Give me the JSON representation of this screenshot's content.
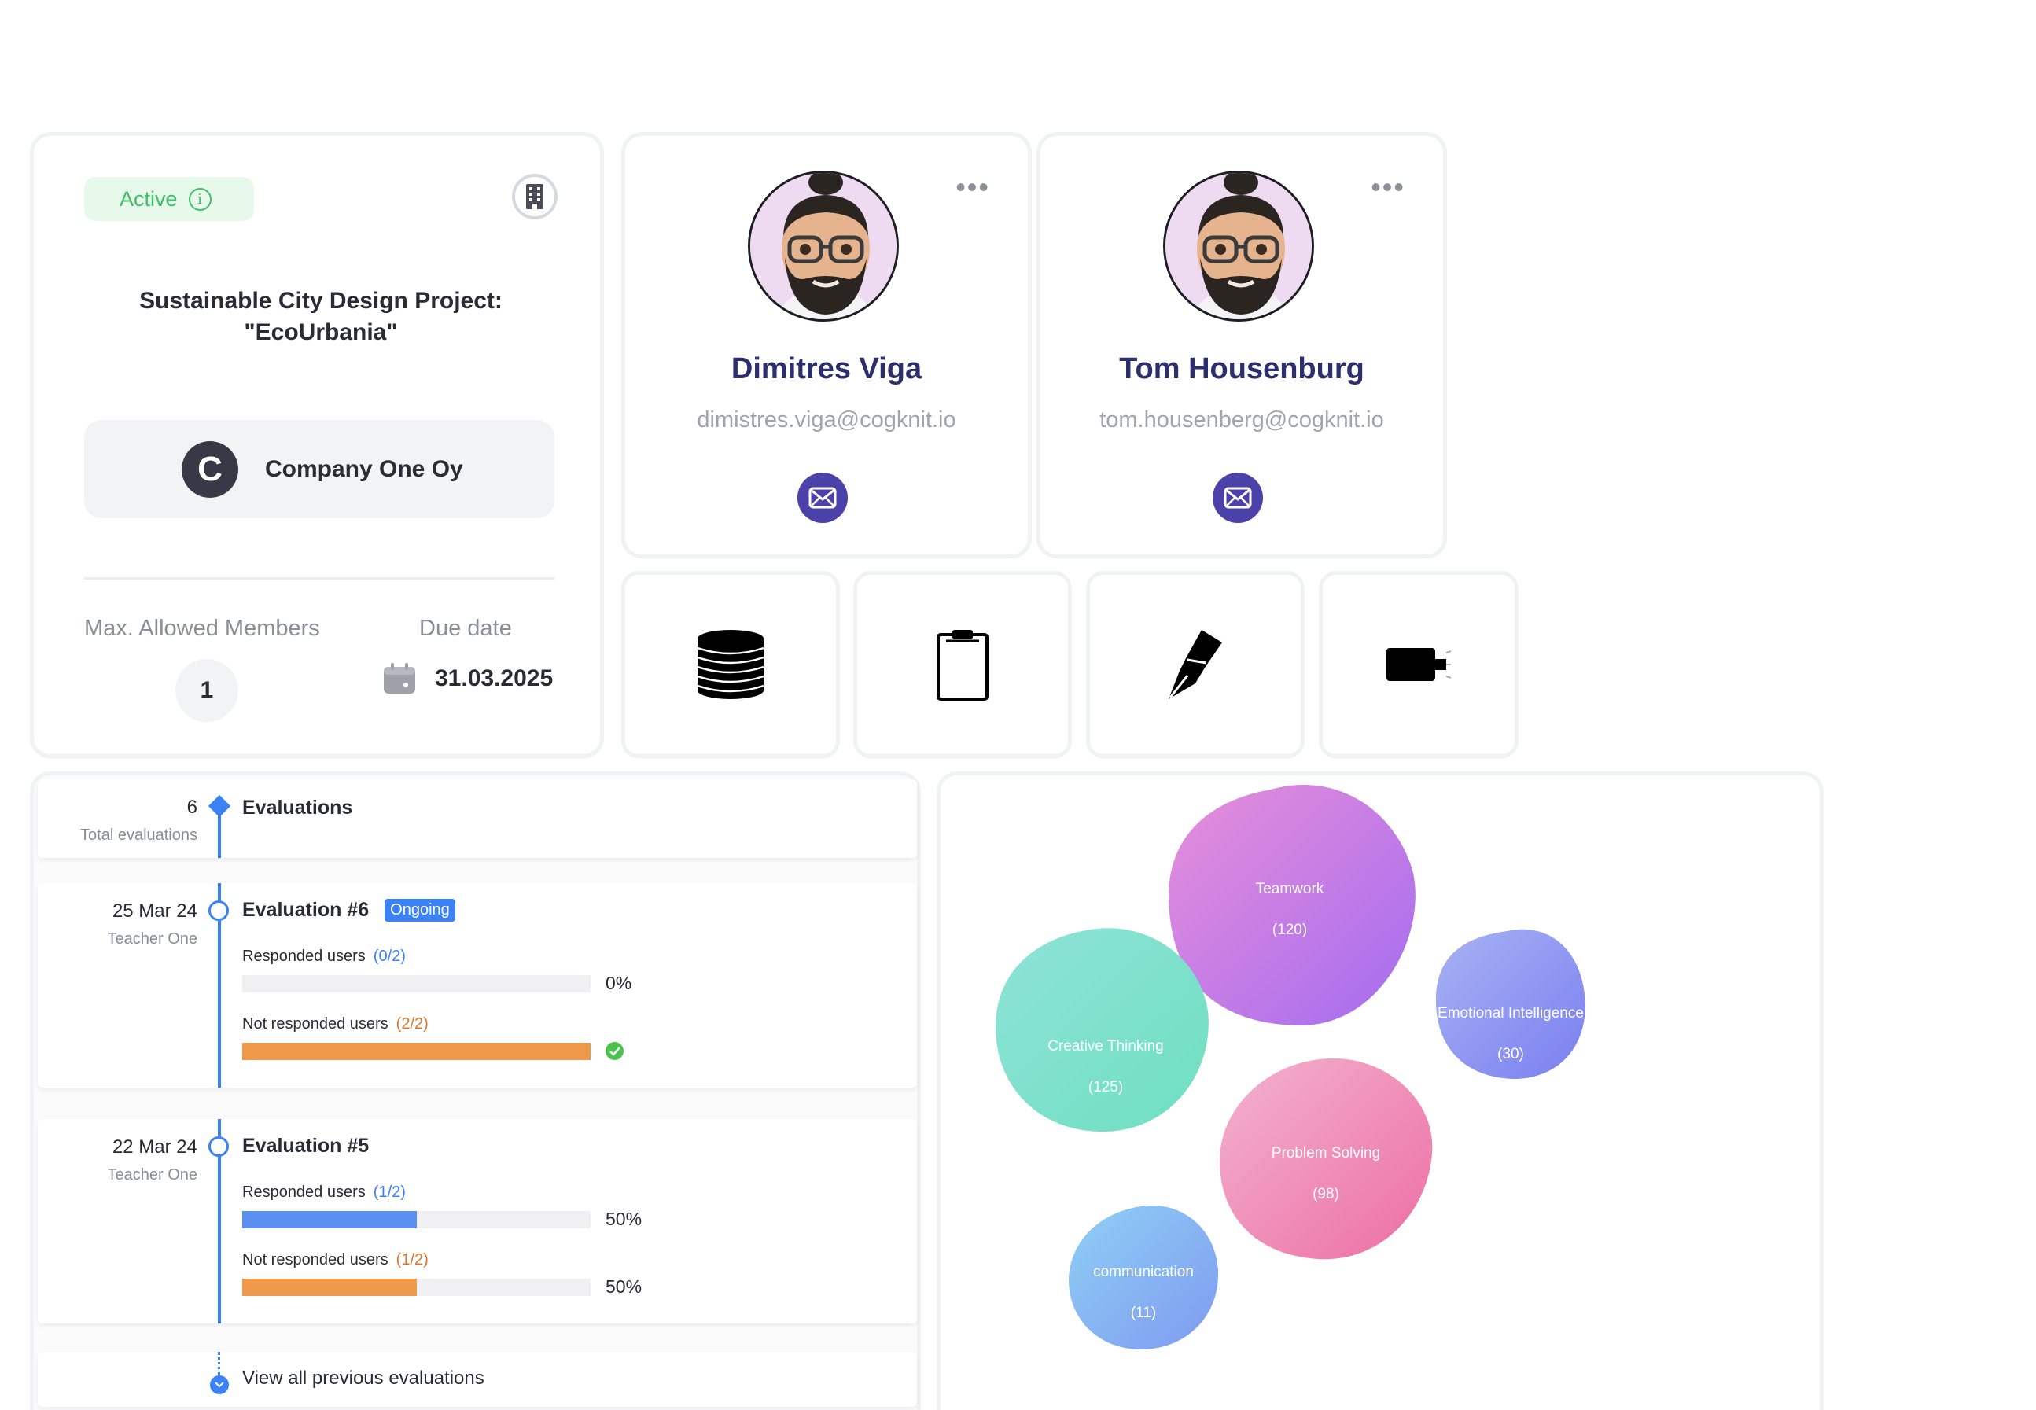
{
  "project": {
    "status": "Active",
    "title_line1": "Sustainable City Design Project:",
    "title_line2": "\"EcoUrbania\"",
    "company_initial": "C",
    "company_name": "Company One Oy",
    "max_members_label": "Max. Allowed Members",
    "max_members_value": "1",
    "due_label": "Due date",
    "due_value": "31.03.2025"
  },
  "people": [
    {
      "name": "Dimitres Viga",
      "email": "dimistres.viga@cogknit.io"
    },
    {
      "name": "Tom Housenburg",
      "email": "tom.housenberg@cogknit.io"
    }
  ],
  "tools": [
    {
      "icon": "database-stack-icon"
    },
    {
      "icon": "clipboard-icon"
    },
    {
      "icon": "pen-nib-icon"
    },
    {
      "icon": "video-camera-icon"
    }
  ],
  "evaluations": {
    "total_count": "6",
    "total_label": "Total evaluations",
    "heading": "Evaluations",
    "items": [
      {
        "date": "25 Mar 24",
        "teacher": "Teacher One",
        "title": "Evaluation #6",
        "badge": "Ongoing",
        "responded_label": "Responded users",
        "responded_count": "(0/2)",
        "responded_pct": "0%",
        "responded_fraction": 0,
        "not_responded_label": "Not responded users",
        "not_responded_count": "(2/2)",
        "not_responded_fraction": 1
      },
      {
        "date": "22 Mar 24",
        "teacher": "Teacher One",
        "title": "Evaluation #5",
        "responded_label": "Responded users",
        "responded_count": "(1/2)",
        "responded_pct": "50%",
        "responded_fraction": 0.5,
        "not_responded_label": "Not responded users",
        "not_responded_count": "(1/2)",
        "not_responded_pct": "50%",
        "not_responded_fraction": 0.5
      }
    ],
    "view_all": "View all previous evaluations"
  },
  "skills": [
    {
      "name": "Teamwork",
      "count": "(120)"
    },
    {
      "name": "Emotional Intelligence",
      "count": "(30)"
    },
    {
      "name": "Creative Thinking",
      "count": "(125)"
    },
    {
      "name": "Problem Solving",
      "count": "(98)"
    },
    {
      "name": "communication",
      "count": "(11)"
    }
  ],
  "colors": {
    "accent": "#3b82f6",
    "mail": "#4b41a8",
    "active_green": "#3fbf67",
    "orange": "#ef9a4b",
    "name_navy": "#2c2f6e"
  }
}
